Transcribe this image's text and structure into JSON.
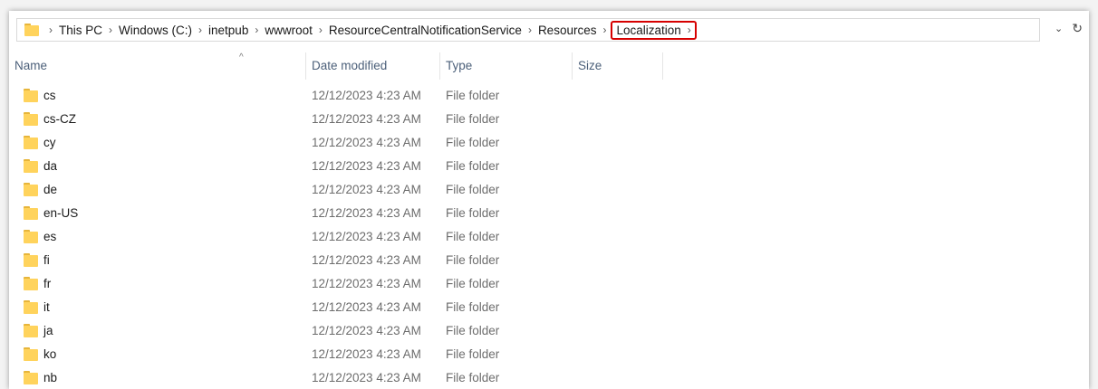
{
  "address": {
    "crumbs": [
      "This PC",
      "Windows (C:)",
      "inetpub",
      "wwwroot",
      "ResourceCentralNotificationService",
      "Resources"
    ],
    "current": "Localization",
    "separator": "›",
    "dropdown_icon": "chevron-down-icon",
    "refresh_icon": "refresh-icon"
  },
  "columns": {
    "name": "Name",
    "date": "Date modified",
    "type": "Type",
    "size": "Size",
    "sort_caret": "^"
  },
  "files": [
    {
      "name": "cs",
      "date": "12/12/2023 4:23 AM",
      "type": "File folder"
    },
    {
      "name": "cs-CZ",
      "date": "12/12/2023 4:23 AM",
      "type": "File folder"
    },
    {
      "name": "cy",
      "date": "12/12/2023 4:23 AM",
      "type": "File folder"
    },
    {
      "name": "da",
      "date": "12/12/2023 4:23 AM",
      "type": "File folder"
    },
    {
      "name": "de",
      "date": "12/12/2023 4:23 AM",
      "type": "File folder"
    },
    {
      "name": "en-US",
      "date": "12/12/2023 4:23 AM",
      "type": "File folder"
    },
    {
      "name": "es",
      "date": "12/12/2023 4:23 AM",
      "type": "File folder"
    },
    {
      "name": "fi",
      "date": "12/12/2023 4:23 AM",
      "type": "File folder"
    },
    {
      "name": "fr",
      "date": "12/12/2023 4:23 AM",
      "type": "File folder"
    },
    {
      "name": "it",
      "date": "12/12/2023 4:23 AM",
      "type": "File folder"
    },
    {
      "name": "ja",
      "date": "12/12/2023 4:23 AM",
      "type": "File folder"
    },
    {
      "name": "ko",
      "date": "12/12/2023 4:23 AM",
      "type": "File folder"
    },
    {
      "name": "nb",
      "date": "12/12/2023 4:23 AM",
      "type": "File folder"
    }
  ],
  "colors": {
    "highlight": "#d60000",
    "folder": "#ffd35c",
    "header_text": "#4c607a"
  }
}
